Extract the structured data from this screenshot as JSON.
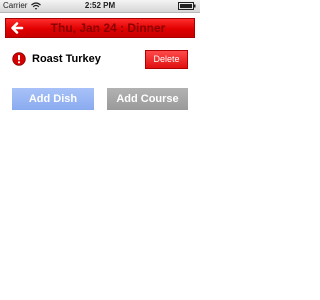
{
  "status_bar": {
    "carrier": "Carrier",
    "time": "2:52 PM",
    "wifi_icon": "wifi-icon",
    "battery_icon": "battery-icon"
  },
  "header": {
    "title": "Thu, Jan 24 : Dinner",
    "back_icon": "back-arrow-icon",
    "color": "#e00000"
  },
  "dishes": [
    {
      "name": "Roast Turkey",
      "status_icon": "alert-icon",
      "delete_label": "Delete"
    }
  ],
  "actions": {
    "add_dish_label": "Add Dish",
    "add_course_label": "Add Course"
  }
}
